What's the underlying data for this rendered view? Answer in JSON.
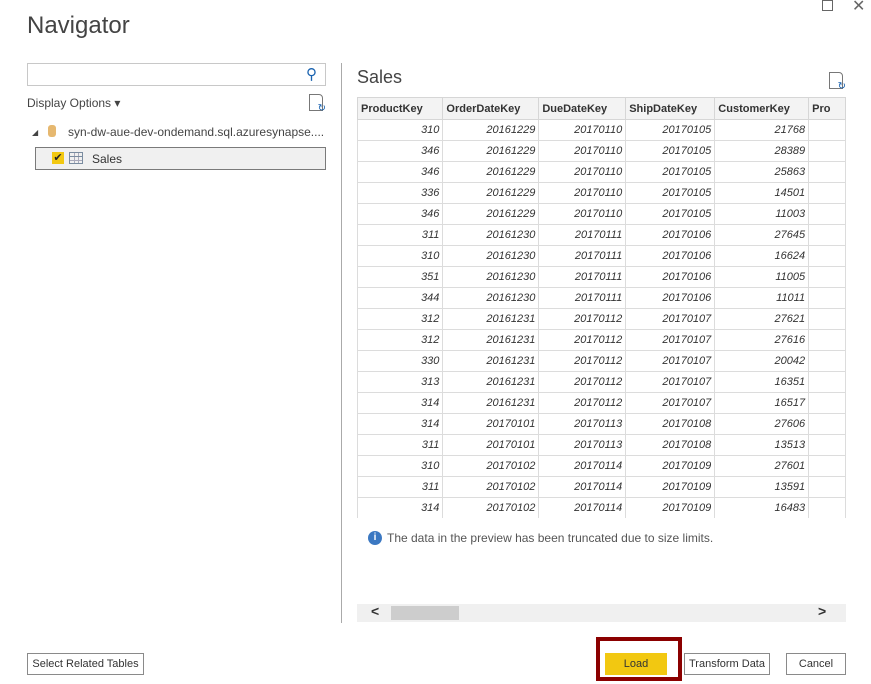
{
  "window": {
    "title": "Navigator"
  },
  "left": {
    "search": {
      "value": "",
      "placeholder": ""
    },
    "display_options": "Display Options ▾",
    "server": "syn-dw-aue-dev-ondemand.sql.azuresynapse....",
    "item": {
      "label": "Sales",
      "checked": true
    }
  },
  "preview": {
    "title": "Sales",
    "columns": [
      "ProductKey",
      "OrderDateKey",
      "DueDateKey",
      "ShipDateKey",
      "CustomerKey",
      "Pro"
    ],
    "rows": [
      [
        "310",
        "20161229",
        "20170110",
        "20170105",
        "21768",
        ""
      ],
      [
        "346",
        "20161229",
        "20170110",
        "20170105",
        "28389",
        ""
      ],
      [
        "346",
        "20161229",
        "20170110",
        "20170105",
        "25863",
        ""
      ],
      [
        "336",
        "20161229",
        "20170110",
        "20170105",
        "14501",
        ""
      ],
      [
        "346",
        "20161229",
        "20170110",
        "20170105",
        "11003",
        ""
      ],
      [
        "311",
        "20161230",
        "20170111",
        "20170106",
        "27645",
        ""
      ],
      [
        "310",
        "20161230",
        "20170111",
        "20170106",
        "16624",
        ""
      ],
      [
        "351",
        "20161230",
        "20170111",
        "20170106",
        "11005",
        ""
      ],
      [
        "344",
        "20161230",
        "20170111",
        "20170106",
        "11011",
        ""
      ],
      [
        "312",
        "20161231",
        "20170112",
        "20170107",
        "27621",
        ""
      ],
      [
        "312",
        "20161231",
        "20170112",
        "20170107",
        "27616",
        ""
      ],
      [
        "330",
        "20161231",
        "20170112",
        "20170107",
        "20042",
        ""
      ],
      [
        "313",
        "20161231",
        "20170112",
        "20170107",
        "16351",
        ""
      ],
      [
        "314",
        "20161231",
        "20170112",
        "20170107",
        "16517",
        ""
      ],
      [
        "314",
        "20170101",
        "20170113",
        "20170108",
        "27606",
        ""
      ],
      [
        "311",
        "20170101",
        "20170113",
        "20170108",
        "13513",
        ""
      ],
      [
        "310",
        "20170102",
        "20170114",
        "20170109",
        "27601",
        ""
      ],
      [
        "311",
        "20170102",
        "20170114",
        "20170109",
        "13591",
        ""
      ],
      [
        "314",
        "20170102",
        "20170114",
        "20170109",
        "16483",
        ""
      ]
    ],
    "info": "The data in the preview has been truncated due to size limits."
  },
  "buttons": {
    "related": "Select Related Tables",
    "load": "Load",
    "transform": "Transform Data",
    "cancel": "Cancel"
  },
  "colors": {
    "accent": "#f2c811",
    "highlight": "#8b0000"
  }
}
